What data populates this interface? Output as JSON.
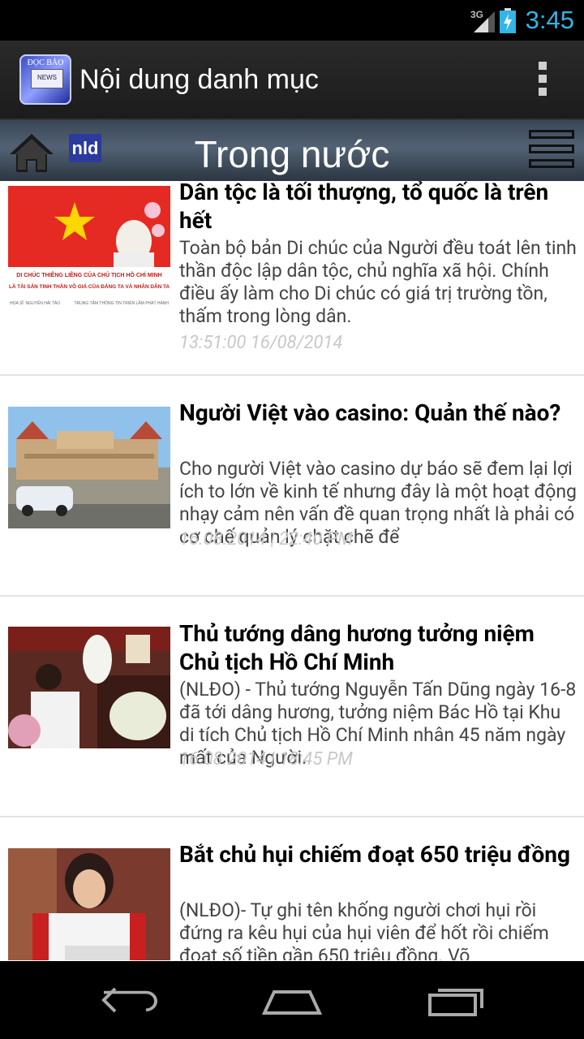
{
  "status_bar": {
    "network": "3G",
    "time": "3:45"
  },
  "app_bar": {
    "icon_label": "ĐỌC BÁO",
    "icon_badge": "NEWS",
    "title": "Nội dung danh mục"
  },
  "category_bar": {
    "logo_text": "nld",
    "title": "Trong nước"
  },
  "articles": [
    {
      "title": "Dân tộc là tối thượng, tổ quốc là trên hết",
      "summary": "Toàn bộ bản Di chúc của Người đều toát lên tinh thần độc lập dân tộc, chủ nghĩa xã hội. Chính điều ấy làm cho Di chúc có giá trị trường tồn, thấm trong lòng dân.",
      "date": "13:51:00 16/08/2014",
      "thumb": {
        "banner_line1": "DI CHÚC THIÊNG LIÊNG CỦA CHỦ TỊCH HỒ CHÍ MINH",
        "banner_line2": "LÀ TÀI SẢN TINH THẦN VÔ GIÁ CỦA ĐẢNG TA VÀ NHÂN DÂN TA",
        "credit_left": "HỌA SĨ: NGUYỄN HẢI TÁO",
        "credit_right": "TRUNG TÂM THÔNG TIN TRIỂN LÃM PHÁT HÀNH"
      }
    },
    {
      "title": "Người Việt vào casino: Quản thế nào?",
      "summary": "Cho người Việt vào casino dự báo sẽ đem lại lợi ích to lớn về kinh tế nhưng đây là một hoạt động nhạy cảm nên vấn đề quan trọng nhất là phải có cơ chế quản lý chặt chẽ để",
      "date": "16.08.2014 | 22:40 PM"
    },
    {
      "title": "Thủ tướng dâng hương tưởng niệm Chủ tịch Hồ Chí Minh",
      "summary": "(NLĐO) - Thủ tướng Nguyễn Tấn Dũng ngày 16-8 đã tới dâng hương, tưởng niệm Bác Hồ tại Khu di tích Chủ tịch Hồ Chí Minh nhân 45 năm ngày mất của Người.",
      "date": "16.08.2014 | 18:45 PM"
    },
    {
      "title": "Bắt chủ hụi chiếm đoạt 650 triệu đồng",
      "summary": "(NLĐO)- Tự ghi tên khống người chơi hụi rồi đứng ra kêu hụi của hụi viên để hốt rồi chiếm đoạt số tiền gần 650 triệu đồng. Võ",
      "date": ""
    }
  ],
  "colors": {
    "clock": "#33b5e5",
    "date_text": "#c8c8c8",
    "category_bar": "#4a5868"
  }
}
